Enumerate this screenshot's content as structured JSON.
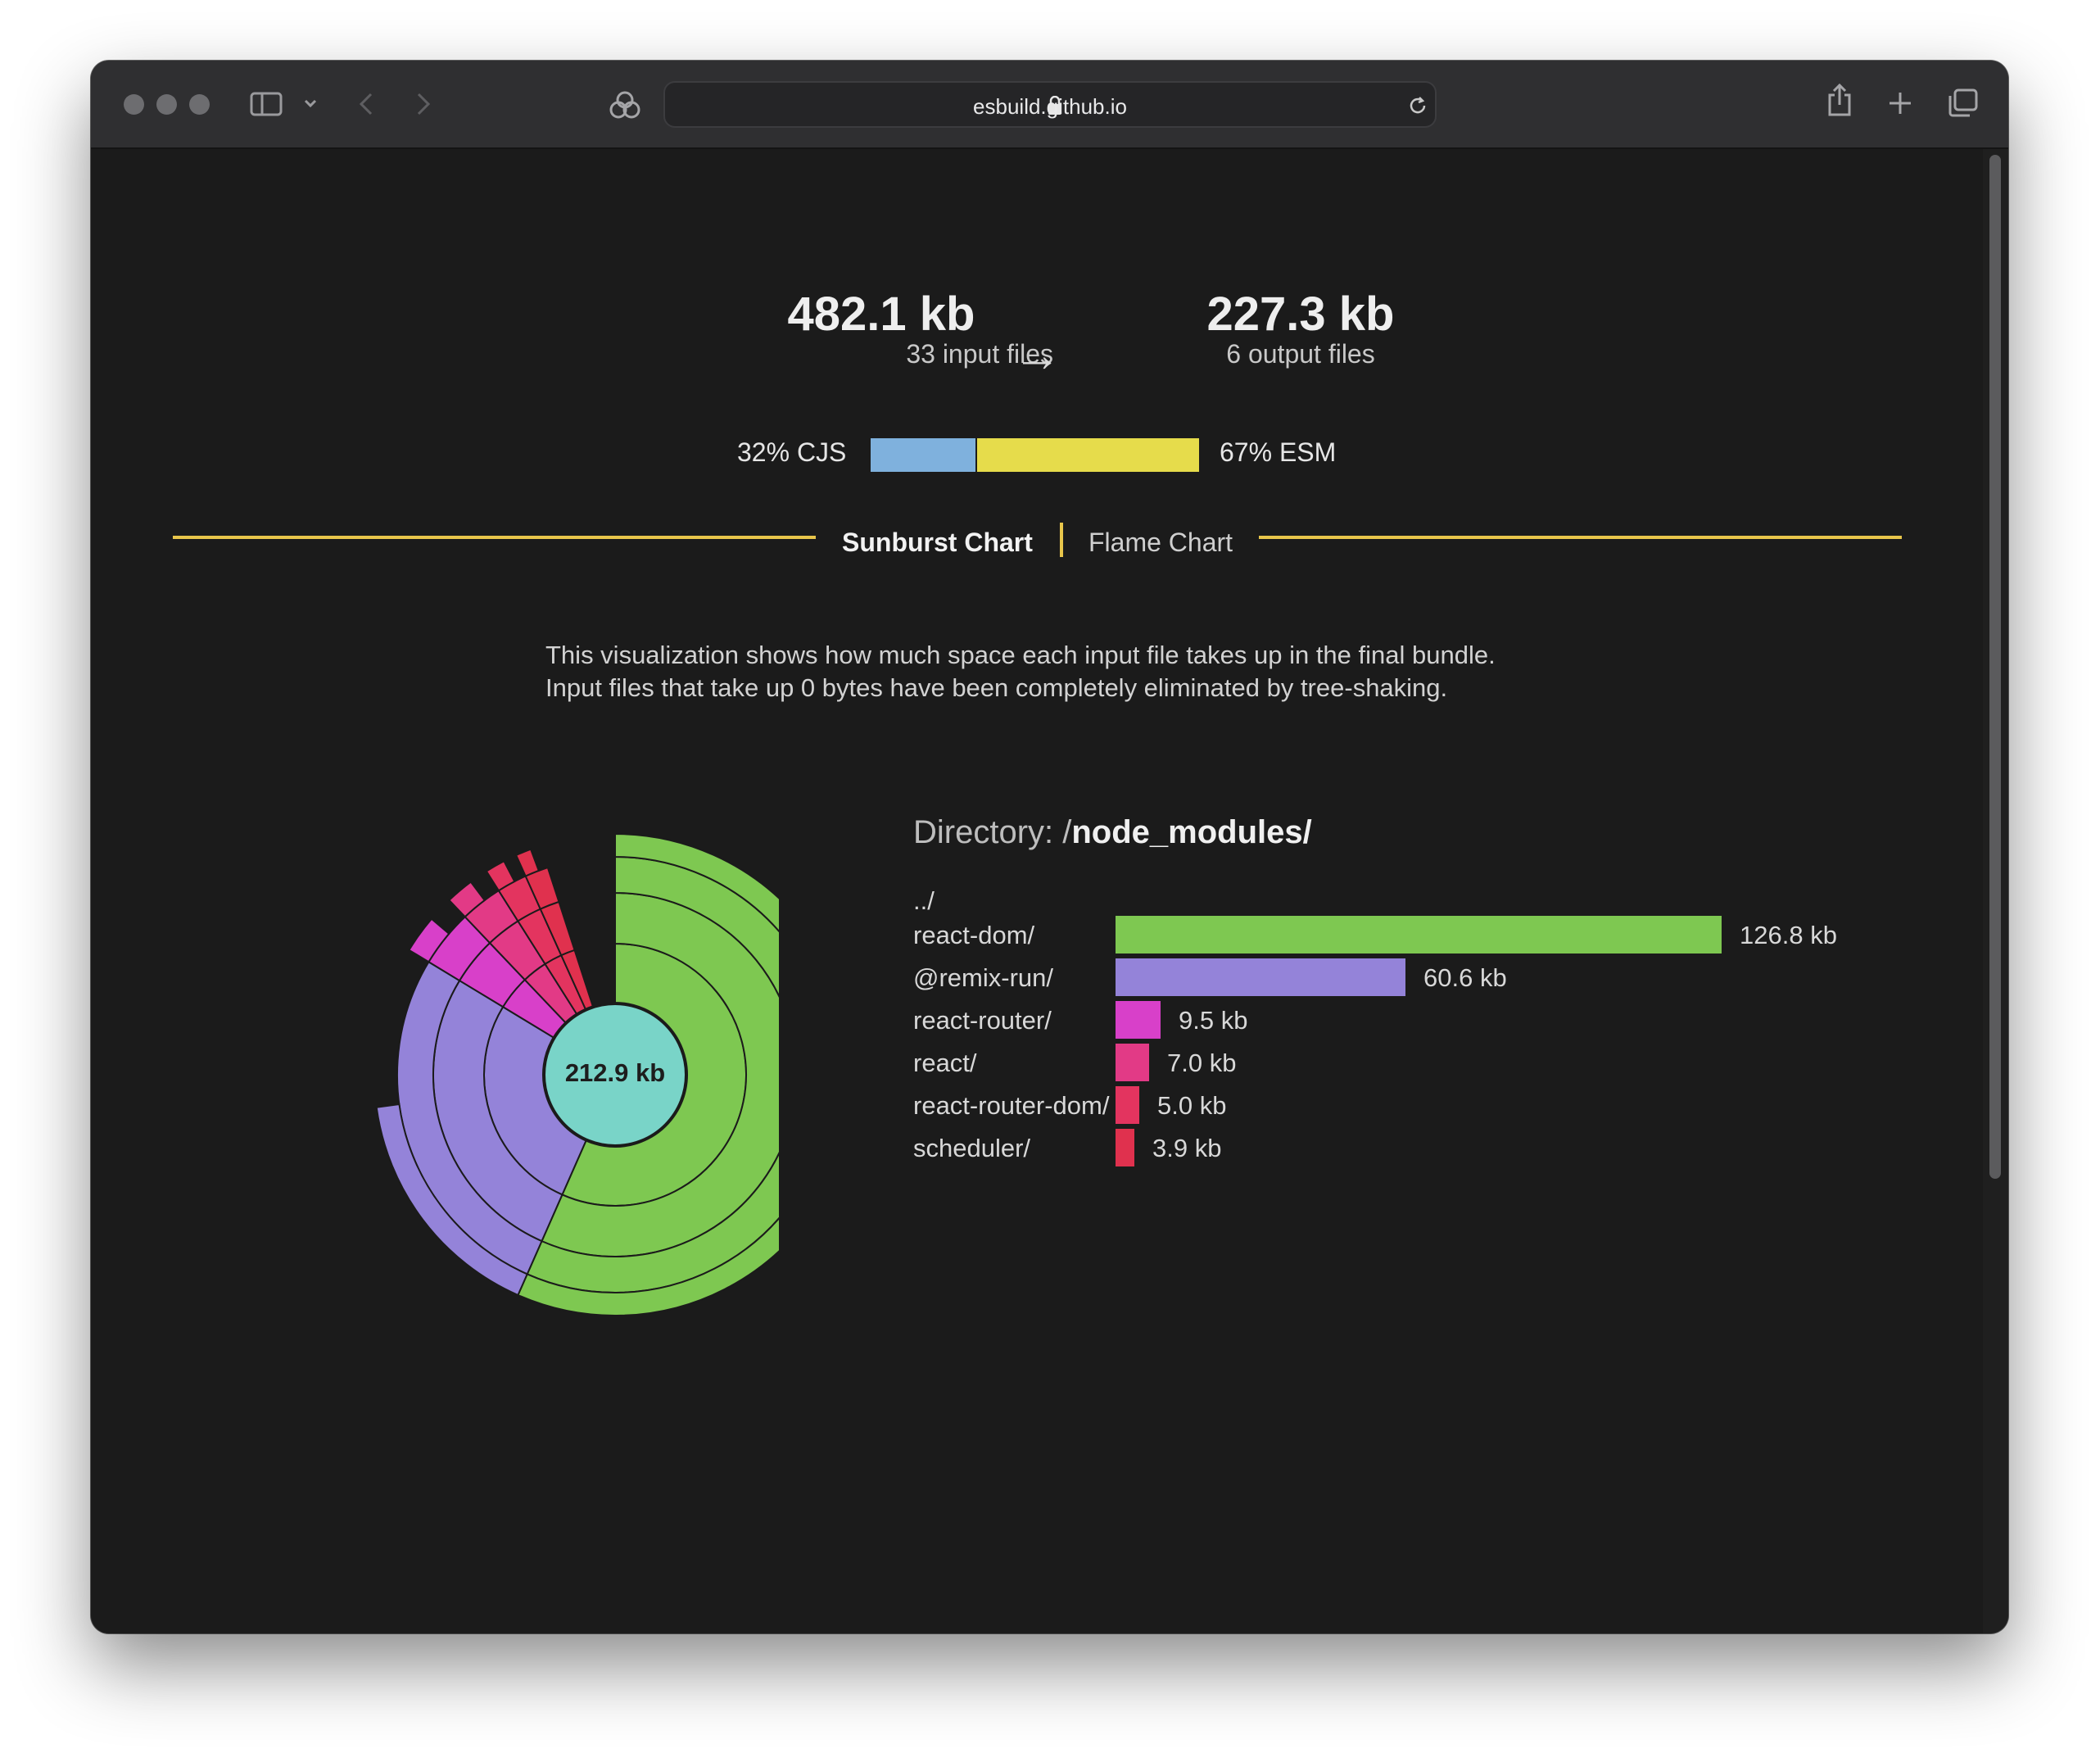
{
  "browser": {
    "url": "esbuild.github.io"
  },
  "summary": {
    "input_size": "482.1 kb",
    "input_files": "33 input files",
    "output_size": "227.3 kb",
    "output_files": "6 output files",
    "arrow": "→",
    "cjs_label": "32% CJS",
    "esm_label": "67% ESM",
    "cjs_fraction": 0.32,
    "esm_fraction": 0.67
  },
  "tabs": [
    {
      "label": "Sunburst Chart",
      "active": true
    },
    {
      "label": "Flame Chart",
      "active": false
    }
  ],
  "description": {
    "line1": "This visualization shows how much space each input file takes up in the final bundle.",
    "line2": "Input files that take up 0 bytes have been completely eliminated by tree-shaking."
  },
  "directory": {
    "prefix": "Directory: /",
    "name": "node_modules/",
    "parent_link": "../",
    "entries": [
      {
        "name": "react-dom/",
        "size_label": "126.8 kb",
        "size_kb": 126.8,
        "color": "#7ec851"
      },
      {
        "name": "@remix-run/",
        "size_label": "60.6 kb",
        "size_kb": 60.6,
        "color": "#9483d9"
      },
      {
        "name": "react-router/",
        "size_label": "9.5 kb",
        "size_kb": 9.5,
        "color": "#d840c9"
      },
      {
        "name": "react/",
        "size_label": "7.0 kb",
        "size_kb": 7.0,
        "color": "#e23a86"
      },
      {
        "name": "react-router-dom/",
        "size_label": "5.0 kb",
        "size_kb": 5.0,
        "color": "#e3345f"
      },
      {
        "name": "scheduler/",
        "size_label": "3.9 kb",
        "size_kb": 3.9,
        "color": "#e0314e"
      }
    ]
  },
  "sunburst": {
    "center_label": "212.9 kb",
    "center_color": "#79d4c8"
  },
  "colors": {
    "accent": "#e8c64b",
    "background": "#1b1b1b",
    "cjs": "#7fb1dd",
    "esm": "#e6dc4b"
  }
}
